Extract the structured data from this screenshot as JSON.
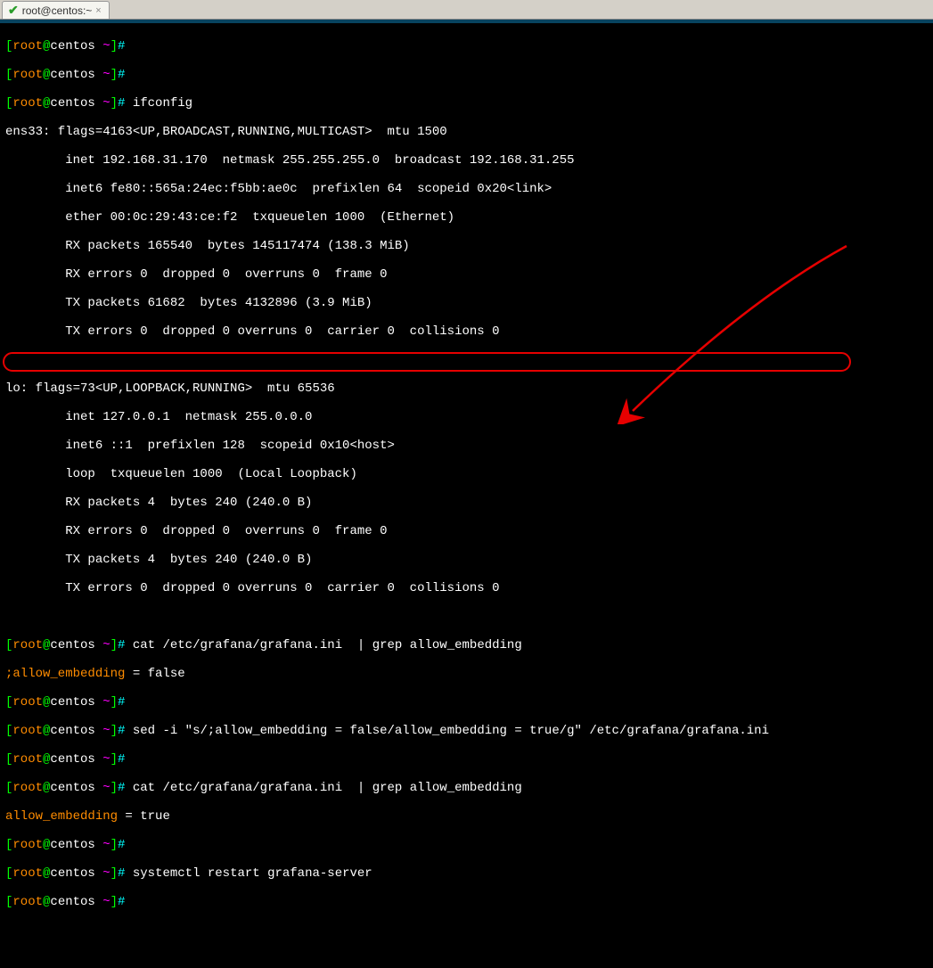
{
  "tab": {
    "title": "root@centos:~"
  },
  "prompt": {
    "lb": "[",
    "user": "root",
    "at": "@",
    "host": "centos ",
    "tilde": "~",
    "rb": "]",
    "hash": "#"
  },
  "commands": {
    "ifconfig": " ifconfig",
    "cat1": " cat /etc/grafana/grafana.ini  | grep allow_embedding",
    "sed": " sed -i \"s/;allow_embedding = false/allow_embedding = true/g\" /etc/grafana/grafana.ini",
    "cat2": " cat /etc/grafana/grafana.ini  | grep allow_embedding",
    "systemctl": " systemctl restart grafana-server"
  },
  "output": {
    "ens_header": "ens33: flags=4163<UP,BROADCAST,RUNNING,MULTICAST>  mtu 1500",
    "ens_inet": "        inet 192.168.31.170  netmask 255.255.255.0  broadcast 192.168.31.255",
    "ens_inet6": "        inet6 fe80::565a:24ec:f5bb:ae0c  prefixlen 64  scopeid 0x20<link>",
    "ens_ether": "        ether 00:0c:29:43:ce:f2  txqueuelen 1000  (Ethernet)",
    "ens_rxp": "        RX packets 165540  bytes 145117474 (138.3 MiB)",
    "ens_rxe": "        RX errors 0  dropped 0  overruns 0  frame 0",
    "ens_txp": "        TX packets 61682  bytes 4132896 (3.9 MiB)",
    "ens_txe": "        TX errors 0  dropped 0 overruns 0  carrier 0  collisions 0",
    "lo_header": "lo: flags=73<UP,LOOPBACK,RUNNING>  mtu 65536",
    "lo_inet": "        inet 127.0.0.1  netmask 255.0.0.0",
    "lo_inet6": "        inet6 ::1  prefixlen 128  scopeid 0x10<host>",
    "lo_loop": "        loop  txqueuelen 1000  (Local Loopback)",
    "lo_rxp": "        RX packets 4  bytes 240 (240.0 B)",
    "lo_rxe": "        RX errors 0  dropped 0  overruns 0  frame 0",
    "lo_txp": "        TX packets 4  bytes 240 (240.0 B)",
    "lo_txe": "        TX errors 0  dropped 0 overruns 0  carrier 0  collisions 0",
    "grep1_key": ";allow_embedding",
    "grep1_rest": " = false",
    "grep2_key": "allow_embedding",
    "grep2_rest": " = true"
  }
}
